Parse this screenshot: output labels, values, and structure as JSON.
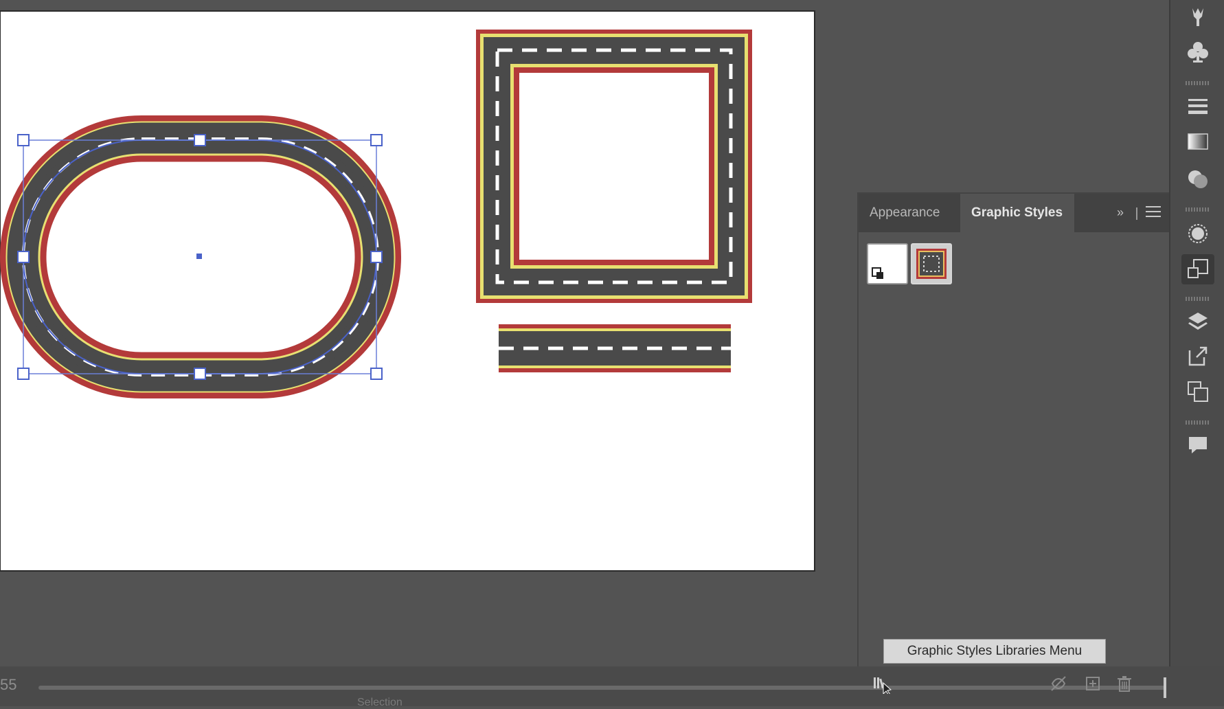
{
  "panel": {
    "tabs": [
      {
        "label": "Appearance",
        "active": false
      },
      {
        "label": "Graphic Styles",
        "active": true
      }
    ],
    "swatches": [
      {
        "name": "Default Graphic Style"
      },
      {
        "name": "Road Style"
      }
    ],
    "tooltip": "Graphic Styles Libraries Menu"
  },
  "status": {
    "zoom": "55",
    "mode_label": "Selection"
  },
  "toolbar_icons": [
    "puppet-warp-icon",
    "club-symbol-icon",
    "stroke-icon",
    "gradient-icon",
    "transparency-icon",
    "appearance-icon",
    "graphic-styles-icon",
    "layers-icon",
    "export-icon",
    "artboards-icon",
    "comments-icon"
  ],
  "colors": {
    "road_asphalt": "#4a4a4a",
    "road_edge": "#b33a3a",
    "road_line": "#e8e070",
    "selection": "#4a62c9",
    "artboard": "#ffffff",
    "ui_bg": "#535353"
  }
}
